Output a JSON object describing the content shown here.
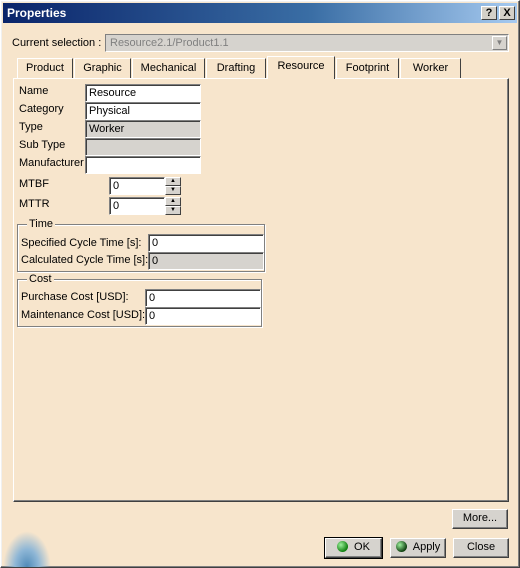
{
  "window": {
    "title": "Properties",
    "help_label": "?",
    "close_label": "X"
  },
  "current_selection": {
    "label": "Current selection :",
    "value": "Resource2.1/Product1.1"
  },
  "tabs": [
    {
      "label": "Product"
    },
    {
      "label": "Graphic"
    },
    {
      "label": "Mechanical"
    },
    {
      "label": "Drafting"
    },
    {
      "label": "Resource",
      "active": true
    },
    {
      "label": "Footprint"
    },
    {
      "label": "Worker"
    }
  ],
  "resource": {
    "name_label": "Name",
    "name_value": "Resource",
    "category_label": "Category",
    "category_value": "Physical",
    "type_label": "Type",
    "type_value": "Worker",
    "subtype_label": "Sub Type",
    "subtype_value": "",
    "manufacturer_label": "Manufacturer",
    "manufacturer_value": "",
    "mtbf_label": "MTBF",
    "mtbf_value": "0",
    "mttr_label": "MTTR",
    "mttr_value": "0"
  },
  "time": {
    "title": "Time",
    "specified_label": "Specified Cycle Time [s]:",
    "specified_value": "0",
    "calculated_label": "Calculated Cycle Time [s]:",
    "calculated_value": "0"
  },
  "cost": {
    "title": "Cost",
    "purchase_label": "Purchase Cost [USD]:",
    "purchase_value": "0",
    "maintenance_label": "Maintenance Cost [USD]:",
    "maintenance_value": "0"
  },
  "buttons": {
    "more": "More...",
    "ok": "OK",
    "apply": "Apply",
    "close": "Close"
  }
}
